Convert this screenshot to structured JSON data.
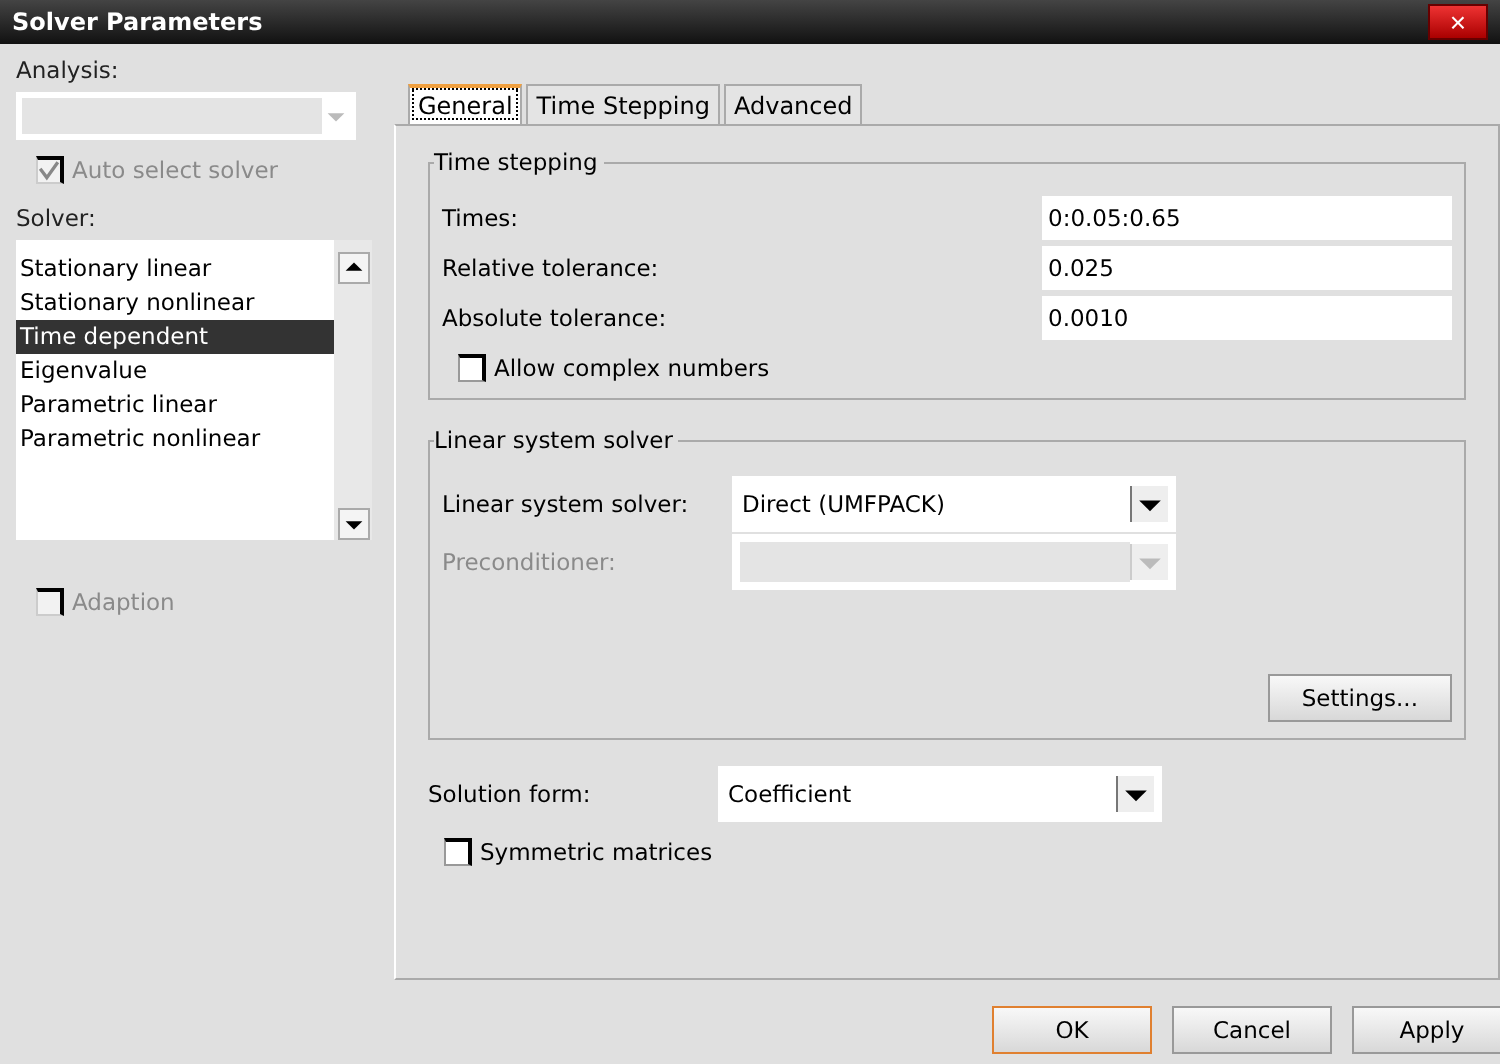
{
  "window": {
    "title": "Solver Parameters",
    "close": "×"
  },
  "analysis": {
    "label": "Analysis:",
    "disabled": true
  },
  "auto_select": {
    "label": "Auto select solver",
    "checked": true,
    "disabled": true
  },
  "solver": {
    "label": "Solver:",
    "items": [
      {
        "label": "Stationary linear",
        "selected": false
      },
      {
        "label": "Stationary nonlinear",
        "selected": false
      },
      {
        "label": "Time dependent",
        "selected": true
      },
      {
        "label": "Eigenvalue",
        "selected": false
      },
      {
        "label": "Parametric linear",
        "selected": false
      },
      {
        "label": "Parametric nonlinear",
        "selected": false
      }
    ]
  },
  "adaption": {
    "label": "Adaption",
    "checked": false,
    "disabled": true
  },
  "tabs": [
    {
      "label": "General",
      "selected": true
    },
    {
      "label": "Time Stepping",
      "selected": false
    },
    {
      "label": "Advanced",
      "selected": false
    }
  ],
  "time_stepping": {
    "title": "Time stepping",
    "fields": [
      {
        "label": "Times:",
        "value": "0:0.05:0.65"
      },
      {
        "label": "Relative tolerance:",
        "value": "0.025"
      },
      {
        "label": "Absolute tolerance:",
        "value": "0.0010"
      }
    ],
    "allow_complex": {
      "label": "Allow complex numbers",
      "checked": false
    }
  },
  "linear_solver": {
    "title": "Linear system solver",
    "solver": {
      "label": "Linear system solver:",
      "value": "Direct (UMFPACK)",
      "disabled": false
    },
    "preconditioner": {
      "label": "Preconditioner:",
      "disabled": true
    },
    "settings_button": "Settings..."
  },
  "solution_form": {
    "label": "Solution form:",
    "value": "Coefficient",
    "disabled": false
  },
  "symmetric": {
    "label": "Symmetric matrices",
    "checked": false
  },
  "buttons": [
    {
      "label": "OK",
      "default": true
    },
    {
      "label": "Cancel",
      "default": false
    },
    {
      "label": "Apply",
      "default": false
    }
  ]
}
